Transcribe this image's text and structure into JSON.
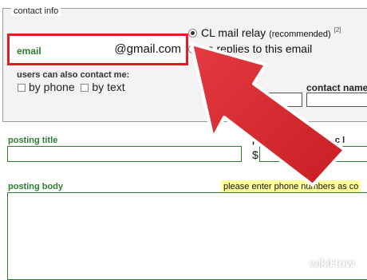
{
  "contact": {
    "legend": "contact info",
    "email_label": "email",
    "email_value": "@gmail.com",
    "relay_label": "CL mail relay",
    "relay_note": "(recommended)",
    "relay_sup": "[2]",
    "no_replies_label": "no replies to this email",
    "also_contact_label": "users can also contact me:",
    "by_phone_label": "by phone",
    "by_text_label": "by text",
    "contact_name_label": "contact name",
    "col_a_fragment": "p"
  },
  "posting": {
    "title_label": "posting title",
    "price_label": "p",
    "price_symbol": "$",
    "location_label": "sp     c l",
    "body_label": "posting body",
    "phone_note": "please enter phone numbers as co"
  },
  "watermark": {
    "part1": "wiki",
    "part2": "How"
  },
  "colors": {
    "label_green": "#2e7d32",
    "highlight_red": "#e21b22",
    "arrow_red": "#d9262c",
    "note_yellow": "#ffff99"
  }
}
